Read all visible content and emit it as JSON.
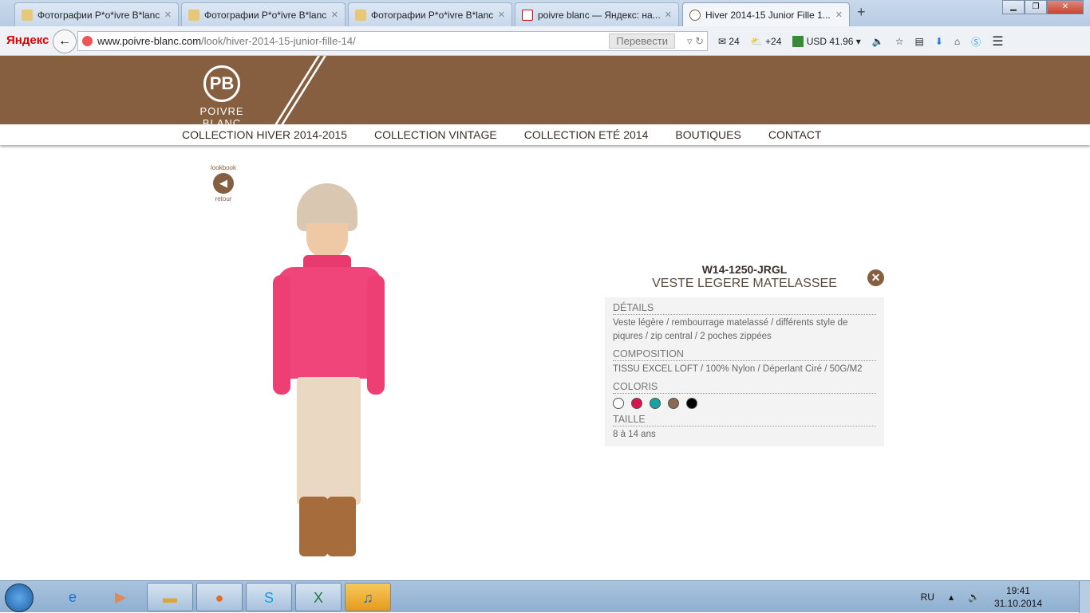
{
  "browser": {
    "tabs": [
      {
        "title": "Фотографии P*o*ivre B*lanc",
        "active": false
      },
      {
        "title": "Фотографии P*o*ivre B*lanc",
        "active": false
      },
      {
        "title": "Фотографии P*o*ivre B*lanc",
        "active": false
      },
      {
        "title": "poivre blanc — Яндекс: на...",
        "active": false
      },
      {
        "title": "Hiver 2014-15 Junior Fille 1...",
        "active": true
      }
    ],
    "brand": "Яндекс",
    "url_domain": "www.poivre-blanc.com",
    "url_path": "/look/hiver-2014-15-junior-fille-14/",
    "translate": "Перевести",
    "mail_count": "24",
    "weather": "+24",
    "currency": "USD 41.96"
  },
  "site": {
    "logo_text": "POIVRE BLANC",
    "logo_mark": "PB",
    "nav": [
      "COLLECTION HIVER 2014-2015",
      "COLLECTION VINTAGE",
      "COLLECTION ETÉ 2014",
      "BOUTIQUES",
      "CONTACT"
    ],
    "back_top": "lookbook",
    "back_bottom": "retour"
  },
  "product": {
    "code": "W14-1250-JRGL",
    "name": "VESTE LEGERE MATELASSEE",
    "details_label": "DÉTAILS",
    "details": "Veste légère / rembourrage matelassé / différents style de piqures / zip central / 2 poches zippées",
    "composition_label": "COMPOSITION",
    "composition": "TISSU EXCEL LOFT / 100% Nylon / Déperlant Ciré / 50G/M2",
    "colors_label": "COLORIS",
    "colors": [
      "#ffffff",
      "#d9134f",
      "#16a3a6",
      "#8a6a52",
      "#000000"
    ],
    "size_label": "TAILLE",
    "size": "8 à 14 ans"
  },
  "taskbar": {
    "lang": "RU",
    "time": "19:41",
    "date": "31.10.2014"
  }
}
